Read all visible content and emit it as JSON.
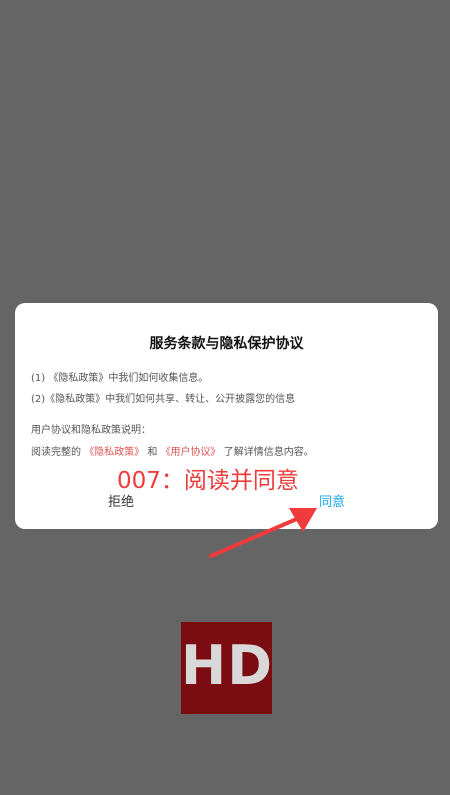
{
  "dialog": {
    "title": "服务条款与隐私保护协议",
    "line1": "(1) 《隐私政策》中我们如何收集信息。",
    "line2": "(2)《隐私政策》中我们如何共享、转让、公开披露您的信息",
    "line3": "用户协议和隐私政策说明：",
    "line4_prefix": "阅读完整的",
    "line4_link1": "《隐私政策》",
    "line4_and": "和",
    "line4_link2": "《用户协议》",
    "line4_suffix": "了解详情信息内容。",
    "reject_label": "拒绝",
    "agree_label": "同意"
  },
  "annotation": {
    "text": "007：阅读并同意"
  },
  "logo": {
    "text": "HD"
  },
  "colors": {
    "background": "#656565",
    "link": "#e25555",
    "agree": "#1aa6e6",
    "annotation": "#ef3b3b",
    "logo_bg": "#7b0c12"
  }
}
